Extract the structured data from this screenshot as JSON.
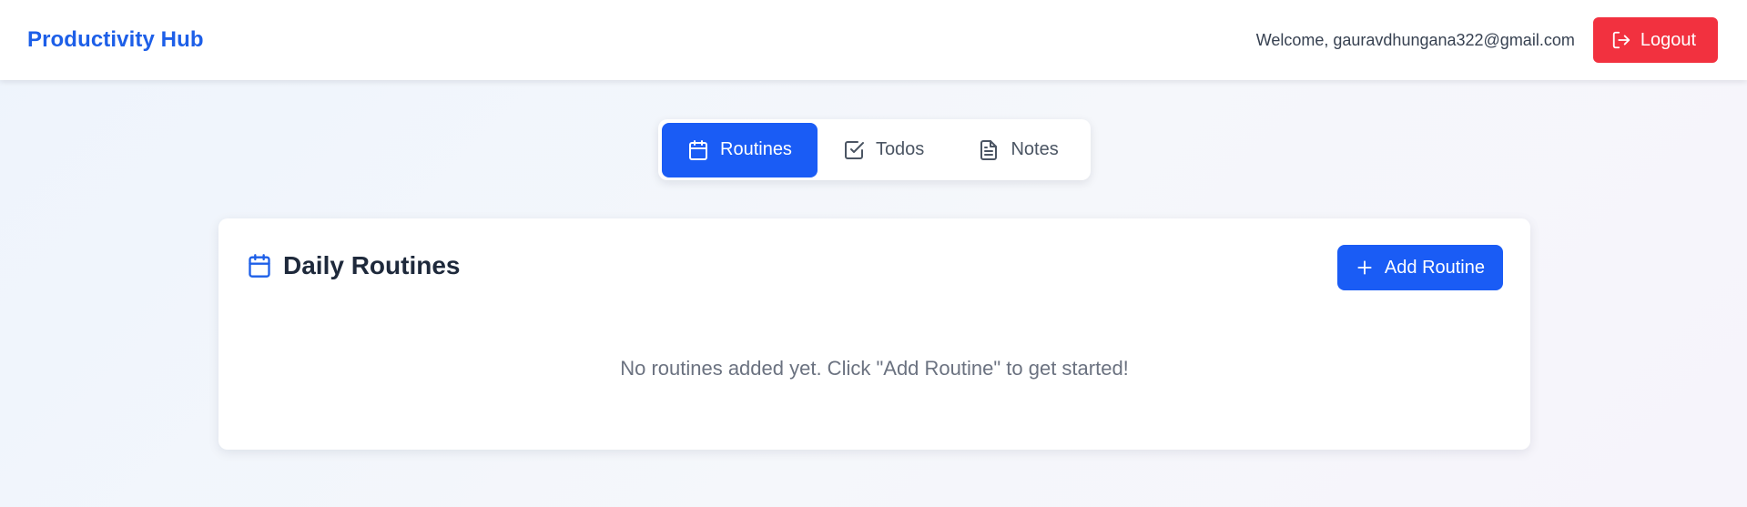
{
  "header": {
    "brand": "Productivity Hub",
    "welcome_text": "Welcome, gauravdhungana322@gmail.com",
    "logout_label": "Logout"
  },
  "tabs": [
    {
      "label": "Routines",
      "icon": "calendar-icon",
      "active": true
    },
    {
      "label": "Todos",
      "icon": "check-square-icon",
      "active": false
    },
    {
      "label": "Notes",
      "icon": "document-icon",
      "active": false
    }
  ],
  "routines_panel": {
    "title": "Daily Routines",
    "title_icon": "calendar-icon",
    "add_button_label": "Add Routine",
    "empty_message": "No routines added yet. Click \"Add Routine\" to get started!"
  },
  "colors": {
    "brand": "#1d5fe8",
    "primary": "#1a5cf5",
    "danger": "#f2313f"
  }
}
